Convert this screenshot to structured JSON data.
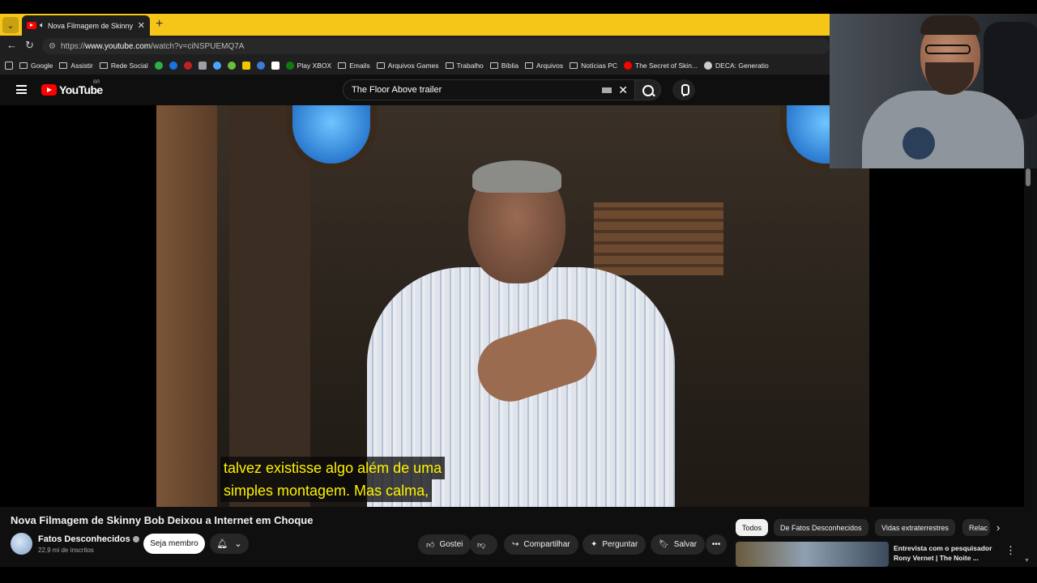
{
  "browser": {
    "tab_title": "Nova Filmagem de Skinny Bob",
    "url_prefix": "https://",
    "url_domain": "www.youtube.com",
    "url_path": "/watch?v=ciNSPUEMQ7A",
    "accent_color": "#f5c518",
    "bookmarks": [
      {
        "label": "Google",
        "icon": "folder-icon"
      },
      {
        "label": "Assistir",
        "icon": "folder-icon"
      },
      {
        "label": "Rede Social",
        "icon": "folder-icon"
      },
      {
        "label": "",
        "icon": "green-dot-icon",
        "color": "#2bb04a"
      },
      {
        "label": "",
        "icon": "blue-dot-icon",
        "color": "#1a73e8"
      },
      {
        "label": "",
        "icon": "red-dot-icon",
        "color": "#c0211f"
      },
      {
        "label": "",
        "icon": "gray-square-icon",
        "color": "#9aa0a6"
      },
      {
        "label": "",
        "icon": "star-icon",
        "color": "#4da3ff"
      },
      {
        "label": "",
        "icon": "green-figure-icon",
        "color": "#6bbf3a"
      },
      {
        "label": "",
        "icon": "yellow-square-icon",
        "color": "#f2c500"
      },
      {
        "label": "",
        "icon": "blue-chart-icon",
        "color": "#3b7bd8"
      },
      {
        "label": "",
        "icon": "s-square-icon",
        "color": "#ffffff"
      },
      {
        "label": "Play XBOX",
        "icon": "xbox-icon",
        "color": "#107c10"
      },
      {
        "label": "Emails",
        "icon": "folder-icon"
      },
      {
        "label": "Arquivos Games",
        "icon": "folder-icon"
      },
      {
        "label": "Trabalho",
        "icon": "folder-icon"
      },
      {
        "label": "Bíblia",
        "icon": "folder-icon"
      },
      {
        "label": "Arquivos",
        "icon": "folder-icon"
      },
      {
        "label": "Notícias PC",
        "icon": "folder-icon"
      },
      {
        "label": "The Secret of Skin...",
        "icon": "youtube-icon",
        "color": "#ff0000"
      },
      {
        "label": "DECA: Generatio",
        "icon": "globe-icon",
        "color": "#cccccc"
      }
    ]
  },
  "youtube": {
    "logo_text": "YouTube",
    "country_code": "BR",
    "search_query": "The Floor Above trailer",
    "subtitle_line1": "talvez existisse algo além de uma",
    "subtitle_line2": "simples montagem. Mas calma,",
    "subtitle_color": "#fff200",
    "video_title": "Nova Filmagem de Skinny Bob Deixou a Internet em Choque",
    "channel_name": "Fatos Desconhecidos",
    "subscribers": "22,9 mi de inscritos",
    "join_label": "Seja membro",
    "actions": {
      "like": "Gostei",
      "share": "Compartilhar",
      "ask": "Perguntar",
      "save": "Salvar"
    },
    "chips": [
      "Todos",
      "De Fatos Desconhecidos",
      "Vidas extraterrestres",
      "Relac"
    ],
    "recommended": {
      "title": "Entrevista com o pesquisador Rony Vernet | The Noite ..."
    }
  }
}
